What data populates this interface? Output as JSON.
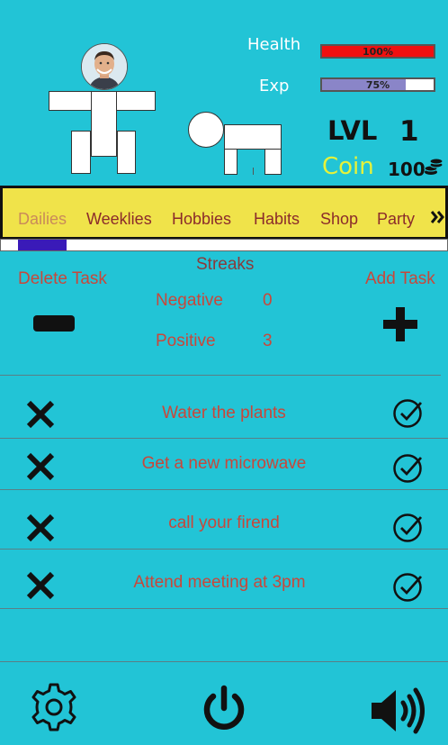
{
  "stats": {
    "health_label": "Health",
    "health_text": "100%",
    "health_fraction": 1.0,
    "exp_label": "Exp",
    "exp_text": "75%",
    "exp_fraction": 0.75,
    "lvl_label": "LVL",
    "lvl_value": "1",
    "coin_label": "Coin",
    "coin_value": "100"
  },
  "colors": {
    "background": "#22c4d6",
    "health_fill": "#f01010",
    "exp_fill": "#8a85c8",
    "tab_bar": "#f0e34a",
    "task_text": "#c9473a",
    "coin_label": "#e6f23a"
  },
  "tabs": [
    {
      "label": "Dailies",
      "active": true
    },
    {
      "label": "Weeklies",
      "active": false
    },
    {
      "label": "Hobbies",
      "active": false
    },
    {
      "label": "Habits",
      "active": false
    },
    {
      "label": "Shop",
      "active": false
    },
    {
      "label": "Party",
      "active": false
    }
  ],
  "tabs_more_icon": "double-chevron-right-icon",
  "streaks": {
    "title": "Streaks",
    "delete_label": "Delete Task",
    "add_label": "Add Task",
    "negative_label": "Negative",
    "negative_value": "0",
    "positive_label": "Positive",
    "positive_value": "3"
  },
  "tasks": [
    {
      "text": "Water the plants"
    },
    {
      "text": "Get a new microwave"
    },
    {
      "text": "call your firend"
    },
    {
      "text": "Attend meeting at 3pm"
    }
  ],
  "footer": {
    "settings_icon": "gear-icon",
    "power_icon": "power-icon",
    "sound_icon": "volume-icon"
  }
}
